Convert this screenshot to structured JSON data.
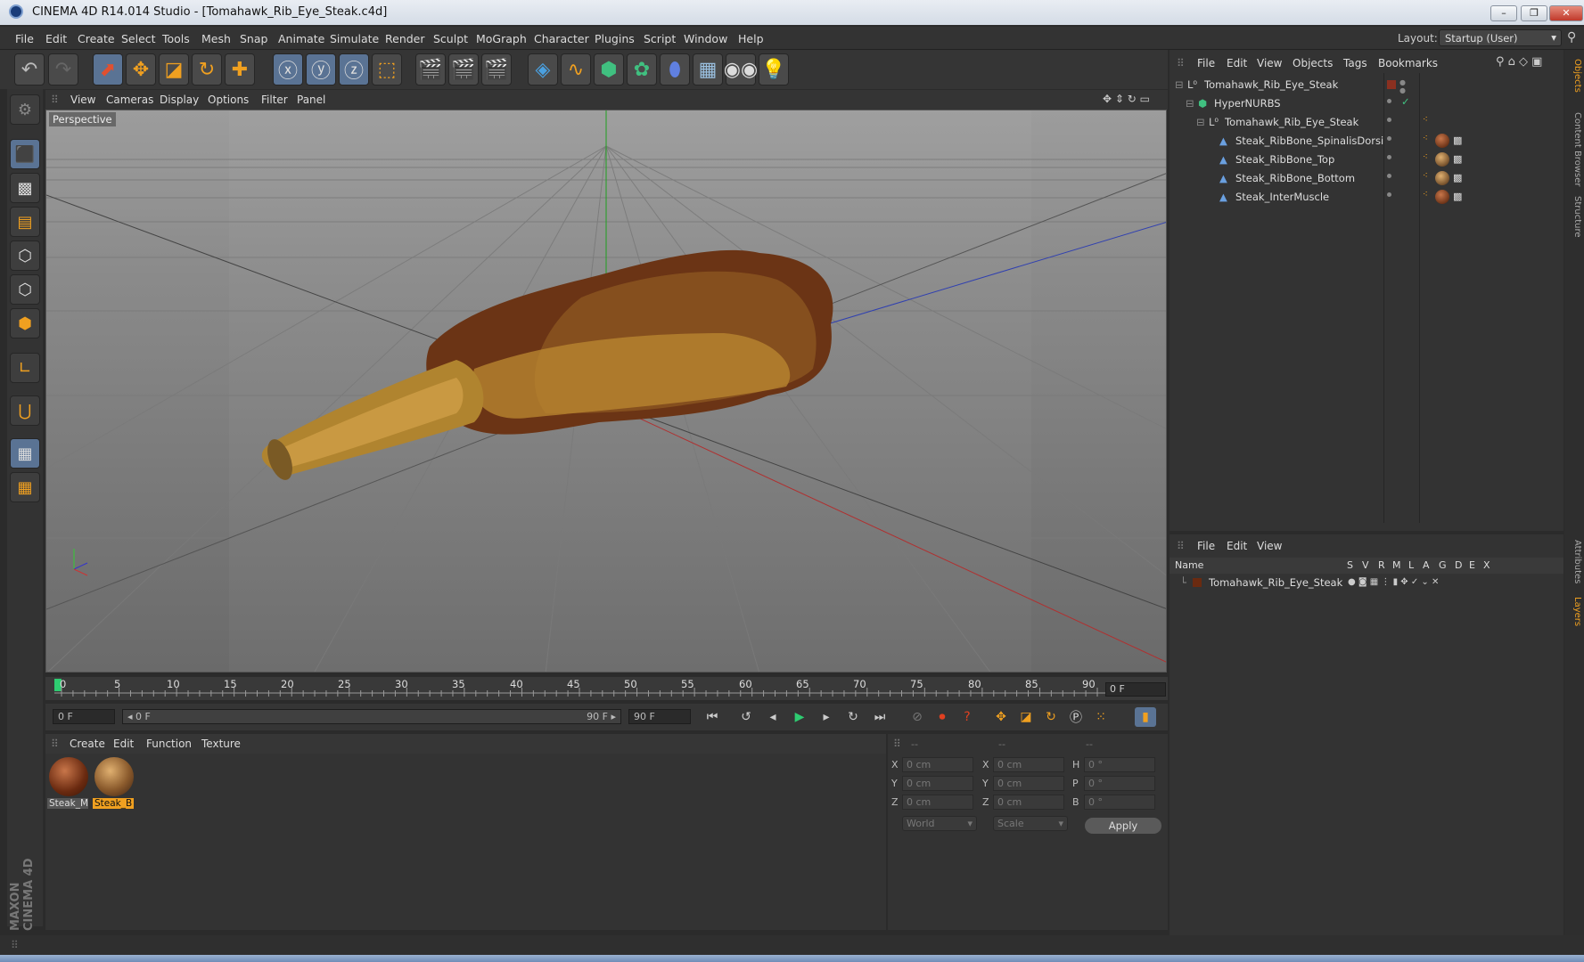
{
  "window": {
    "title": "CINEMA 4D R14.014 Studio - [Tomahawk_Rib_Eye_Steak.c4d]",
    "btn_min": "–",
    "btn_max": "❐",
    "btn_close": "✕"
  },
  "menubar": {
    "items": [
      "File",
      "Edit",
      "Create",
      "Select",
      "Tools",
      "Mesh",
      "Snap",
      "Animate",
      "Simulate",
      "Render",
      "Sculpt",
      "MoGraph",
      "Character",
      "Plugins",
      "Script",
      "Window",
      "Help"
    ],
    "layout_label": "Layout:",
    "layout_value": "Startup (User)"
  },
  "viewport": {
    "menu": [
      "View",
      "Cameras",
      "Display",
      "Options",
      "Filter",
      "Panel"
    ],
    "label": "Perspective"
  },
  "timeline": {
    "ticks": [
      "0",
      "5",
      "10",
      "15",
      "20",
      "25",
      "30",
      "35",
      "40",
      "45",
      "50",
      "55",
      "60",
      "65",
      "70",
      "75",
      "80",
      "85",
      "90"
    ],
    "current_frame": "0 F"
  },
  "transport": {
    "start_field": "0 F",
    "range_start": "◂ 0 F",
    "range_end": "90 F ▸",
    "end_field": "90 F"
  },
  "materials": {
    "menu": [
      "Create",
      "Edit",
      "Function",
      "Texture"
    ],
    "items": [
      {
        "name": "Steak_M",
        "selected": false,
        "color": "#7a3a1c"
      },
      {
        "name": "Steak_B",
        "selected": true,
        "color": "#8a5a2c"
      }
    ]
  },
  "coordinates": {
    "header": [
      "--",
      "--",
      "--"
    ],
    "rows": [
      {
        "a": "X",
        "av": "0 cm",
        "b": "X",
        "bv": "0 cm",
        "c": "H",
        "cv": "0 °"
      },
      {
        "a": "Y",
        "av": "0 cm",
        "b": "Y",
        "bv": "0 cm",
        "c": "P",
        "cv": "0 °"
      },
      {
        "a": "Z",
        "av": "0 cm",
        "b": "Z",
        "bv": "0 cm",
        "c": "B",
        "cv": "0 °"
      }
    ],
    "mode": "World",
    "scale": "Scale",
    "apply": "Apply"
  },
  "objects": {
    "menu": [
      "File",
      "Edit",
      "View",
      "Objects",
      "Tags",
      "Bookmarks"
    ],
    "tree": [
      {
        "name": "Tomahawk_Rib_Eye_Steak",
        "level": 0,
        "icon": "null-icon"
      },
      {
        "name": "HyperNURBS",
        "level": 1,
        "icon": "hypernurbs-icon"
      },
      {
        "name": "Tomahawk_Rib_Eye_Steak",
        "level": 2,
        "icon": "null-icon"
      },
      {
        "name": "Steak_RibBone_SpinalisDorsi",
        "level": 3,
        "icon": "polygon-icon"
      },
      {
        "name": "Steak_RibBone_Top",
        "level": 3,
        "icon": "polygon-icon"
      },
      {
        "name": "Steak_RibBone_Bottom",
        "level": 3,
        "icon": "polygon-icon"
      },
      {
        "name": "Steak_InterMuscle",
        "level": 3,
        "icon": "polygon-icon"
      }
    ]
  },
  "layers": {
    "menu": [
      "File",
      "Edit",
      "View"
    ],
    "columns": [
      "Name",
      "S",
      "V",
      "R",
      "M",
      "L",
      "A",
      "G",
      "D",
      "E",
      "X"
    ],
    "rows": [
      {
        "name": "Tomahawk_Rib_Eye_Steak"
      }
    ]
  },
  "right_tabs": [
    "Objects",
    "Content Browser",
    "Structure",
    "Attributes",
    "Layers"
  ],
  "branding": "MAXON CINEMA 4D",
  "colors": {
    "accent": "#f0a020",
    "selection": "#5a7394"
  }
}
